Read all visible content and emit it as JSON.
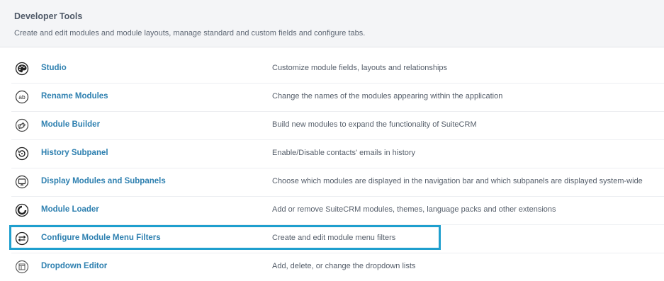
{
  "header": {
    "title": "Developer Tools",
    "description": "Create and edit modules and module layouts, manage standard and custom fields and configure tabs."
  },
  "tools": [
    {
      "label": "Studio",
      "description": "Customize module fields, layouts and relationships",
      "icon": "palette-icon"
    },
    {
      "label": "Rename Modules",
      "description": "Change the names of the modules appearing within the application",
      "icon": "ab-text-icon"
    },
    {
      "label": "Module Builder",
      "description": "Build new modules to expand the functionality of SuiteCRM",
      "icon": "module-builder-icon"
    },
    {
      "label": "History Subpanel",
      "description": "Enable/Disable contacts' emails in history",
      "icon": "history-icon"
    },
    {
      "label": "Display Modules and Subpanels",
      "description": "Choose which modules are displayed in the navigation bar and which subpanels are displayed system-wide",
      "icon": "monitor-icon"
    },
    {
      "label": "Module Loader",
      "description": "Add or remove SuiteCRM modules, themes, language packs and other extensions",
      "icon": "loader-icon"
    },
    {
      "label": "Configure Module Menu Filters",
      "description": "Create and edit module menu filters",
      "icon": "menu-filters-icon"
    },
    {
      "label": "Dropdown Editor",
      "description": "Add, delete, or change the dropdown lists",
      "icon": "dropdown-icon"
    }
  ],
  "highlighted_item": "Configure Module Menu Filters",
  "colors": {
    "link": "#2e80b0",
    "highlight_border": "#1f9fce",
    "header_bg": "#f4f5f7"
  }
}
